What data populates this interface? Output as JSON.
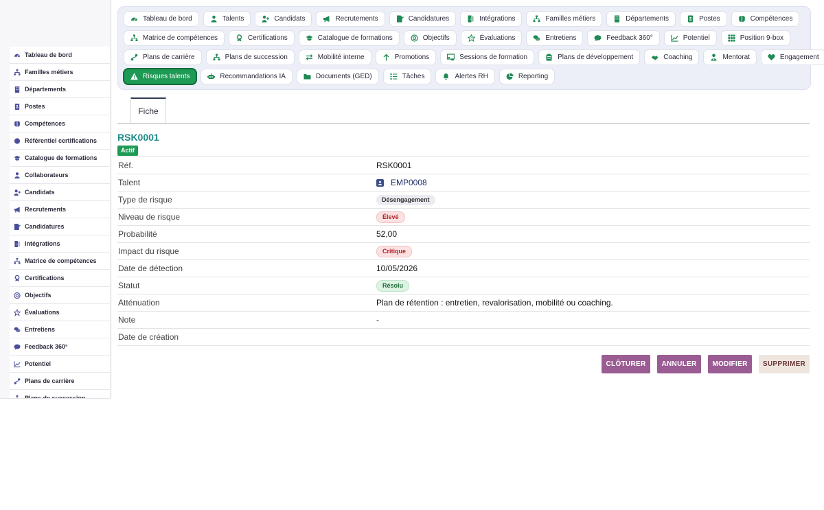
{
  "sidebar": {
    "items": [
      {
        "label": "Tableau de bord",
        "icon": "gauge-icon"
      },
      {
        "label": "Familles métiers",
        "icon": "sitemap-icon"
      },
      {
        "label": "Départements",
        "icon": "building-icon"
      },
      {
        "label": "Postes",
        "icon": "id-badge-icon"
      },
      {
        "label": "Compétences",
        "icon": "brain-icon"
      },
      {
        "label": "Référentiel certifications",
        "icon": "certificate-icon"
      },
      {
        "label": "Catalogue de formations",
        "icon": "graduation-cap-icon"
      },
      {
        "label": "Collaborateurs",
        "icon": "user-icon"
      },
      {
        "label": "Candidats",
        "icon": "user-plus-icon"
      },
      {
        "label": "Recrutements",
        "icon": "megaphone-icon"
      },
      {
        "label": "Candidatures",
        "icon": "file-signature-icon"
      },
      {
        "label": "Intégrations",
        "icon": "door-icon"
      },
      {
        "label": "Matrice de compétences",
        "icon": "sitemap-icon"
      },
      {
        "label": "Certifications",
        "icon": "award-icon"
      },
      {
        "label": "Objectifs",
        "icon": "target-icon"
      },
      {
        "label": "Évaluations",
        "icon": "star-icon"
      },
      {
        "label": "Entretiens",
        "icon": "comments-icon"
      },
      {
        "label": "Feedback 360°",
        "icon": "comment-icon"
      },
      {
        "label": "Potentiel",
        "icon": "chart-line-icon"
      },
      {
        "label": "Plans de carrière",
        "icon": "route-icon"
      },
      {
        "label": "Plans de succession",
        "icon": "sitemap-icon"
      }
    ]
  },
  "nav": {
    "rows": [
      [
        {
          "label": "Tableau de bord",
          "icon": "gauge-icon"
        },
        {
          "label": "Talents",
          "icon": "user-icon"
        },
        {
          "label": "Candidats",
          "icon": "user-plus-icon"
        },
        {
          "label": "Recrutements",
          "icon": "megaphone-icon"
        },
        {
          "label": "Candidatures",
          "icon": "file-signature-icon"
        },
        {
          "label": "Intégrations",
          "icon": "door-icon"
        },
        {
          "label": "Familles métiers",
          "icon": "sitemap-icon"
        },
        {
          "label": "Départements",
          "icon": "building-icon"
        },
        {
          "label": "Postes",
          "icon": "id-badge-icon"
        },
        {
          "label": "Compétences",
          "icon": "brain-icon"
        }
      ],
      [
        {
          "label": "Matrice de compétences",
          "icon": "sitemap-icon"
        },
        {
          "label": "Certifications",
          "icon": "award-icon"
        },
        {
          "label": "Catalogue de formations",
          "icon": "graduation-cap-icon"
        },
        {
          "label": "Objectifs",
          "icon": "target-icon"
        },
        {
          "label": "Évaluations",
          "icon": "star-icon"
        },
        {
          "label": "Entretiens",
          "icon": "comments-icon"
        },
        {
          "label": "Feedback 360°",
          "icon": "comment-icon"
        },
        {
          "label": "Potentiel",
          "icon": "chart-line-icon"
        },
        {
          "label": "Position 9-box",
          "icon": "grid-icon"
        }
      ],
      [
        {
          "label": "Plans de carrière",
          "icon": "route-icon"
        },
        {
          "label": "Plans de succession",
          "icon": "sitemap-icon"
        },
        {
          "label": "Mobilité interne",
          "icon": "exchange-icon"
        },
        {
          "label": "Promotions",
          "icon": "arrow-up-icon"
        },
        {
          "label": "Sessions de formation",
          "icon": "chalkboard-icon"
        },
        {
          "label": "Plans de développement",
          "icon": "clipboard-icon"
        },
        {
          "label": "Coaching",
          "icon": "handshake-icon"
        },
        {
          "label": "Mentorat",
          "icon": "user-tie-icon"
        },
        {
          "label": "Engagement",
          "icon": "heart-icon"
        }
      ],
      [
        {
          "label": "Risques talents",
          "icon": "warning-icon",
          "active": true
        },
        {
          "label": "Recommandations IA",
          "icon": "robot-icon"
        },
        {
          "label": "Documents (GED)",
          "icon": "folder-icon"
        },
        {
          "label": "Tâches",
          "icon": "tasks-icon"
        },
        {
          "label": "Alertes RH",
          "icon": "bell-icon"
        },
        {
          "label": "Reporting",
          "icon": "pie-chart-icon"
        }
      ]
    ]
  },
  "tabs": {
    "fiche": "Fiche"
  },
  "record": {
    "title": "RSK0001",
    "status": "Actif",
    "fields": {
      "ref": {
        "label": "Réf.",
        "value": "RSK0001"
      },
      "talent": {
        "label": "Talent",
        "value": "EMP0008"
      },
      "type": {
        "label": "Type de risque",
        "value": "Désengagement"
      },
      "niveau": {
        "label": "Niveau de risque",
        "value": "Élevé"
      },
      "proba": {
        "label": "Probabilité",
        "value": "52,00"
      },
      "impact": {
        "label": "Impact du risque",
        "value": "Critique"
      },
      "date_detect": {
        "label": "Date de détection",
        "value": "10/05/2026"
      },
      "statut": {
        "label": "Statut",
        "value": "Résolu"
      },
      "attenuation": {
        "label": "Atténuation",
        "value": "Plan de rétention : entretien, revalorisation, mobilité ou coaching."
      },
      "note": {
        "label": "Note",
        "value": "-"
      },
      "date_creation": {
        "label": "Date de création",
        "value": ""
      }
    }
  },
  "actions": {
    "cloturer": "CLÔTURER",
    "annuler": "ANNULER",
    "modifier": "MODIFIER",
    "supprimer": "SUPPRIMER"
  },
  "colors": {
    "accent_green": "#1f9a55",
    "title_teal": "#1f8a8a",
    "action_purple": "#9a5c93",
    "action_beige": "#efe5df",
    "icon_indigo": "#4a4f9c"
  }
}
